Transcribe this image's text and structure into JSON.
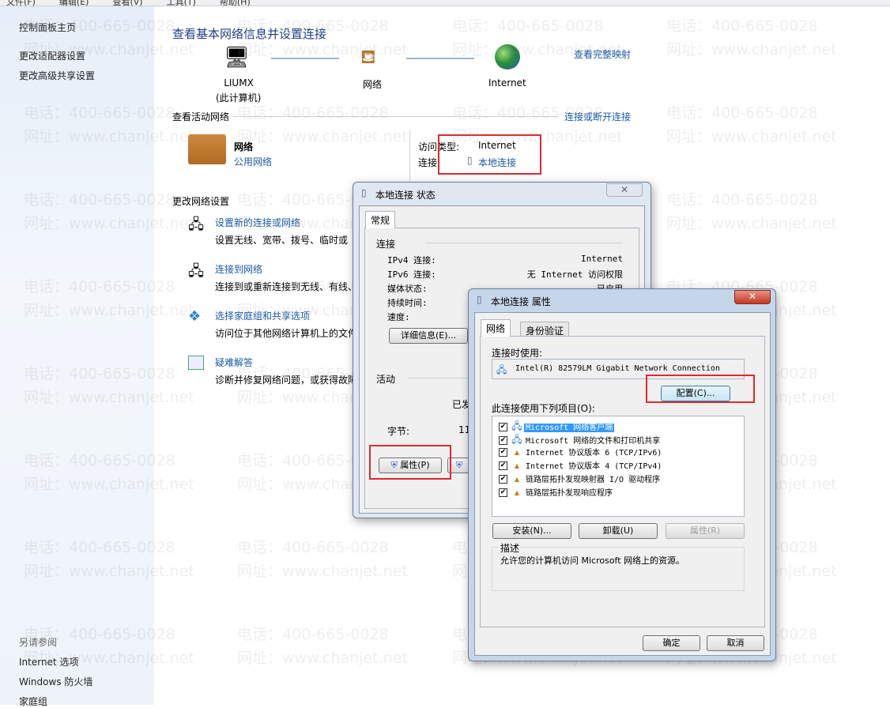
{
  "menu": [
    "文件(F)",
    "编辑(E)",
    "查看(V)",
    "工具(T)",
    "帮助(H)"
  ],
  "sidebar": {
    "home": "控制面板主页",
    "items": [
      "更改适配器设置",
      "更改高级共享设置"
    ],
    "see_also": "另请参阅",
    "links": [
      "Internet 选项",
      "Windows 防火墙",
      "家庭组"
    ]
  },
  "main": {
    "title": "查看基本网络信息并设置连接",
    "map_link": "查看完整映射",
    "computer": "LIUMX",
    "computer_sub": "(此计算机)",
    "network": "网络",
    "internet": "Internet",
    "active_header": "查看活动网络",
    "connect_link": "连接或断开连接",
    "net_name": "网络",
    "net_type": "公用网络",
    "access_label": "访问类型:",
    "access_value": "Internet",
    "conn_label": "连接:",
    "conn_value": "本地连接",
    "change_header": "更改网络设置",
    "tasks": [
      {
        "title": "设置新的连接或网络",
        "desc": "设置无线、宽带、拨号、临时或"
      },
      {
        "title": "连接到网络",
        "desc": "连接到或重新连接到无线、有线、"
      },
      {
        "title": "选择家庭组和共享选项",
        "desc": "访问位于其他网络计算机上的文件"
      },
      {
        "title": "疑难解答",
        "desc": "诊断并修复网络问题，或获得故障"
      }
    ]
  },
  "status_dialog": {
    "title": "本地连接 状态",
    "tab": "常规",
    "conn_group": "连接",
    "rows": [
      {
        "label": "IPv4 连接:",
        "value": "Internet"
      },
      {
        "label": "IPv6 连接:",
        "value": "无 Internet 访问权限"
      },
      {
        "label": "媒体状态:",
        "value": "已启用"
      },
      {
        "label": "持续时间:",
        "value": ""
      },
      {
        "label": "速度:",
        "value": ""
      }
    ],
    "details_btn": "详细信息(E)...",
    "activity_group": "活动",
    "sent": "已发",
    "bytes_label": "字节:",
    "bytes_value": "11,",
    "props_btn": "属性(P)"
  },
  "props_dialog": {
    "title": "本地连接 属性",
    "tabs": [
      "网络",
      "身份验证"
    ],
    "connect_using": "连接时使用:",
    "adapter": "Intel(R) 82579LM Gigabit Network Connection",
    "config_btn": "配置(C)...",
    "items_label": "此连接使用下列项目(O):",
    "items": [
      "Microsoft 网络客户端",
      "Microsoft 网络的文件和打印机共享",
      "Internet 协议版本 6 (TCP/IPv6)",
      "Internet 协议版本 4 (TCP/IPv4)",
      "链路层拓扑发现映射器 I/O 驱动程序",
      "链路层拓扑发现响应程序"
    ],
    "install_btn": "安装(N)...",
    "uninstall_btn": "卸载(U)",
    "properties_btn": "属性(R)",
    "desc_label": "描述",
    "desc": "允许您的计算机访问 Microsoft 网络上的资源。",
    "ok": "确定",
    "cancel": "取消"
  },
  "watermark": {
    "phone": "电话：400-665-0028",
    "site": "网址：www.chanjet.net"
  },
  "colors": {
    "highlight": "#e0282e",
    "link": "#1a5aa6",
    "selection": "#3399ff"
  }
}
